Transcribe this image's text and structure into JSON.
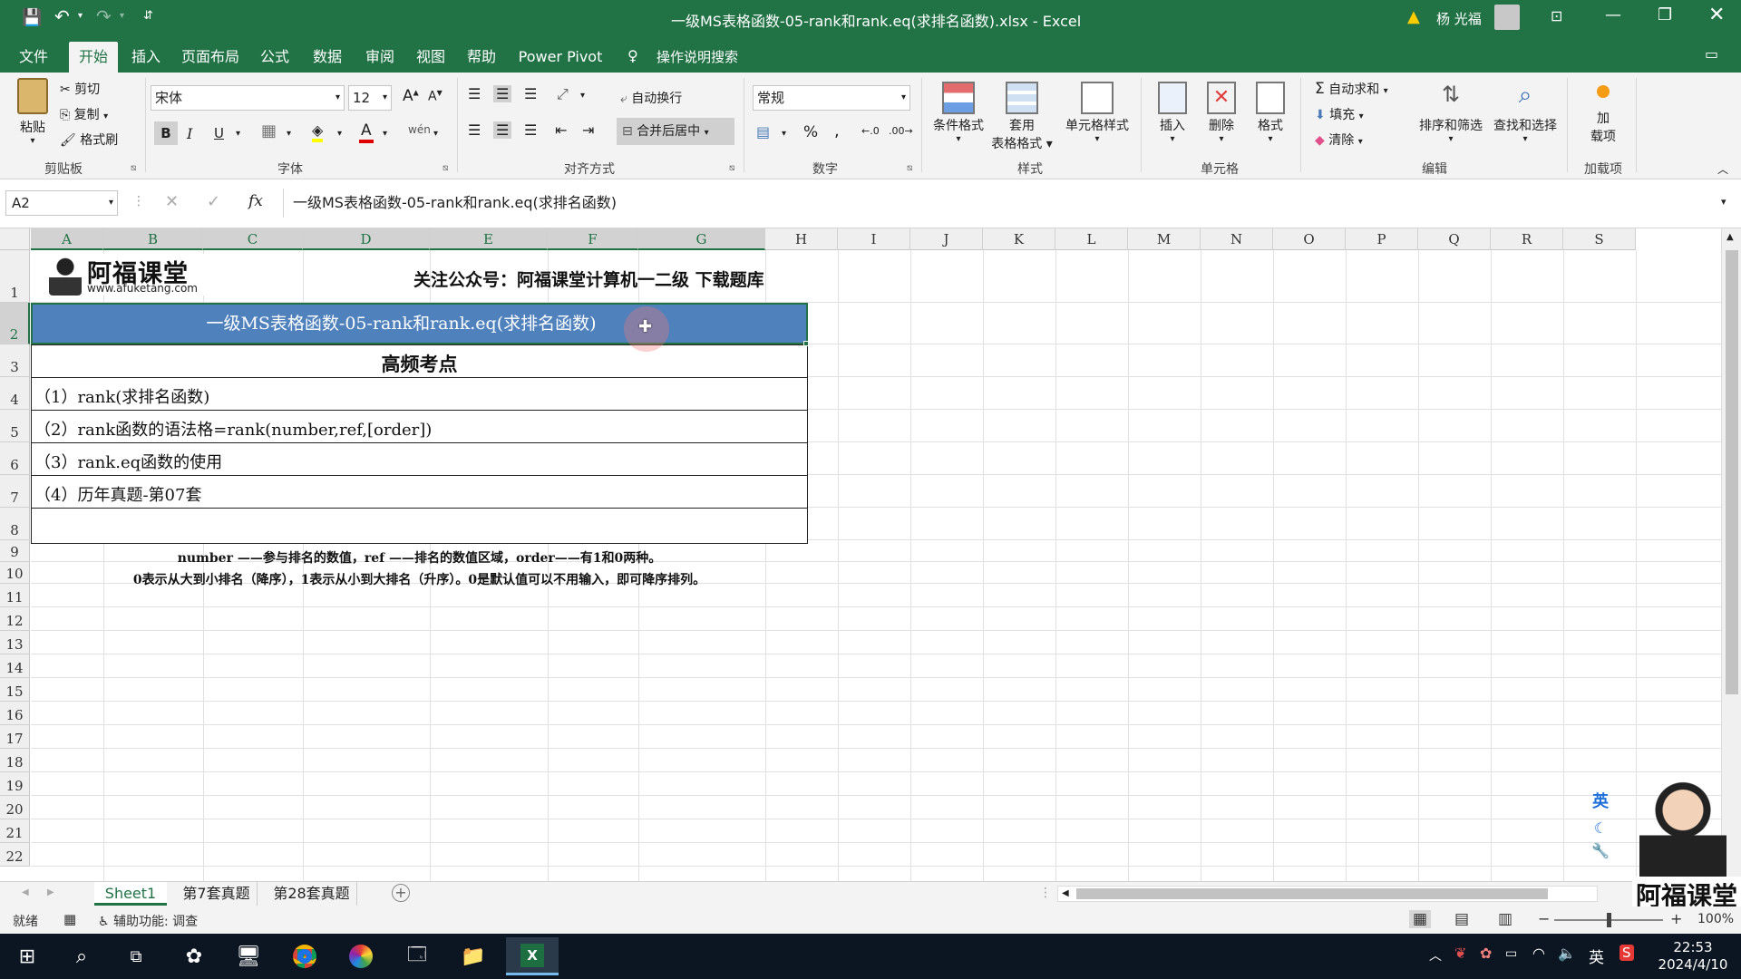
{
  "titlebar": {
    "title": "一级MS表格函数-05-rank和rank.eq(求排名函数).xlsx  -  Excel",
    "user_name": "杨 光福",
    "qat_more": "⇵"
  },
  "tabs": [
    "文件",
    "开始",
    "插入",
    "页面布局",
    "公式",
    "数据",
    "审阅",
    "视图",
    "帮助",
    "Power Pivot"
  ],
  "tell_me": "操作说明搜索",
  "ribbon": {
    "clipboard": {
      "paste": "粘贴",
      "cut": "剪切",
      "copy": "复制",
      "format_painter": "格式刷",
      "label": "剪贴板"
    },
    "font": {
      "name": "宋体",
      "size": "12",
      "label": "字体",
      "grow": "A",
      "shrink": "A",
      "bold": "B",
      "italic": "I",
      "underline": "U",
      "font_color_glyph": "A",
      "phonetic": "wén"
    },
    "alignment": {
      "wrap": "自动换行",
      "merge": "合并后居中",
      "label": "对齐方式"
    },
    "number": {
      "format": "常规",
      "label": "数字",
      "percent": "%",
      "comma": ","
    },
    "styles": {
      "conditional": "条件格式",
      "table_line1": "套用",
      "table_line2": "表格格式",
      "cell_styles": "单元格样式",
      "label": "样式"
    },
    "cells": {
      "insert": "插入",
      "delete": "删除",
      "format": "格式",
      "label": "单元格"
    },
    "editing": {
      "autosum": "自动求和",
      "fill": "填充",
      "clear": "清除",
      "sort": "排序和筛选",
      "find": "查找和选择",
      "label": "编辑"
    },
    "addins": {
      "line1": "加",
      "line2": "载项",
      "label": "加载项"
    }
  },
  "formula_bar": {
    "name_box": "A2",
    "fx": "fx",
    "content": "一级MS表格函数-05-rank和rank.eq(求排名函数)"
  },
  "columns": [
    "A",
    "B",
    "C",
    "D",
    "E",
    "F",
    "G",
    "H",
    "I",
    "J",
    "K",
    "L",
    "M",
    "N",
    "O",
    "P",
    "Q",
    "R",
    "S"
  ],
  "rows": [
    "1",
    "2",
    "3",
    "4",
    "5",
    "6",
    "7",
    "8",
    "9",
    "10",
    "11",
    "12",
    "13",
    "14",
    "15",
    "16",
    "17",
    "18",
    "19",
    "20",
    "21",
    "22"
  ],
  "cells": {
    "logo_name": "阿福课堂",
    "logo_url": "www.afuketang.com",
    "follow": "关注公众号：阿福课堂计算机一二级  下载题库",
    "title": "一级MS表格函数-05-rank和rank.eq(求排名函数)",
    "heading": "高频考点",
    "item1": "（1）rank(求排名函数)",
    "item2": "（2）rank函数的语法格=rank(number,ref,[order])",
    "item3": "（3）rank.eq函数的使用",
    "item4": "（4）历年真题-第07套",
    "note1": "number ——参与排名的数值，ref ——排名的数值区域，order——有1和0两种。",
    "note2": "0表示从大到小排名（降序），1表示从小到大排名（升序）。0是默认值可以不用输入，即可降序排列。"
  },
  "sheets": [
    "Sheet1",
    "第7套真题",
    "第28套真题"
  ],
  "status": {
    "ready": "就绪",
    "accessibility": "辅助功能: 调查",
    "zoom": "100%"
  },
  "side_panel": {
    "lang": "英"
  },
  "watermark": "阿福课堂",
  "taskbar": {
    "ime": "英",
    "time": "22:53",
    "date": "2024/4/10"
  },
  "colors": {
    "excel_green": "#217346",
    "selection_fill": "#4f81bd",
    "taskbar": "#0c1622"
  }
}
